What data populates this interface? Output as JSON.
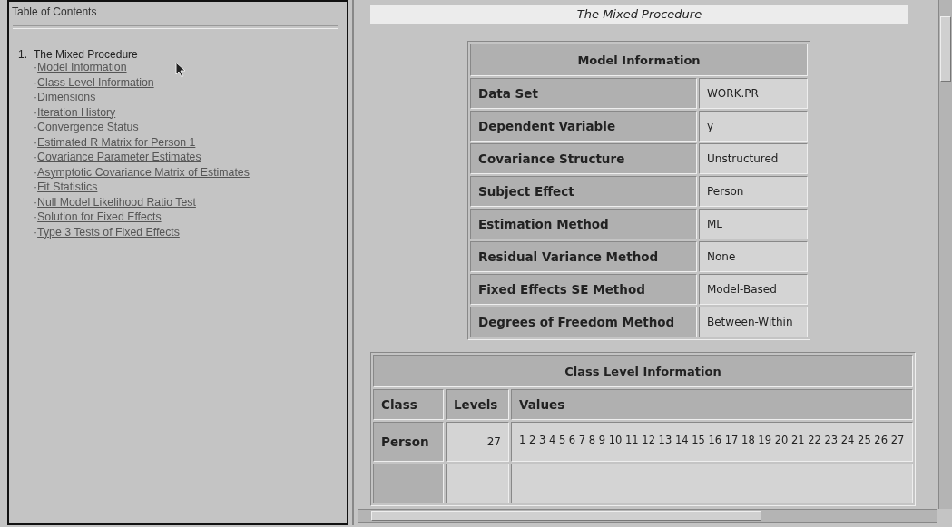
{
  "toc": {
    "title": "Table of Contents",
    "sections": [
      {
        "number": "1.",
        "title": "The Mixed Procedure",
        "links": [
          {
            "bullet": "·",
            "label": "Model Information"
          },
          {
            "bullet": "·",
            "label": "Class Level Information"
          },
          {
            "bullet": "·",
            "label": "Dimensions"
          },
          {
            "bullet": "·",
            "label": "Iteration History"
          },
          {
            "bullet": "·",
            "label": "Convergence Status"
          },
          {
            "bullet": "·",
            "label": "Estimated R Matrix for Person 1"
          },
          {
            "bullet": "·",
            "label": "Covariance Parameter Estimates"
          },
          {
            "bullet": "·",
            "label": "Asymptotic Covariance Matrix of Estimates"
          },
          {
            "bullet": "·",
            "label": "Fit Statistics"
          },
          {
            "bullet": "·",
            "label": "Null Model Likelihood Ratio Test"
          },
          {
            "bullet": "·",
            "label": "Solution for Fixed Effects"
          },
          {
            "bullet": "·",
            "label": "Type 3 Tests of Fixed Effects"
          }
        ]
      }
    ]
  },
  "output": {
    "procedure_title": "The Mixed Procedure",
    "model_information": {
      "title": "Model Information",
      "rows": [
        {
          "label": "Data Set",
          "value": "WORK.PR"
        },
        {
          "label": "Dependent Variable",
          "value": "y"
        },
        {
          "label": "Covariance Structure",
          "value": "Unstructured"
        },
        {
          "label": "Subject Effect",
          "value": "Person"
        },
        {
          "label": "Estimation Method",
          "value": "ML"
        },
        {
          "label": "Residual Variance Method",
          "value": "None"
        },
        {
          "label": "Fixed Effects SE Method",
          "value": "Model-Based"
        },
        {
          "label": "Degrees of Freedom Method",
          "value": "Between-Within"
        }
      ]
    },
    "class_level_information": {
      "title": "Class Level Information",
      "columns": [
        "Class",
        "Levels",
        "Values"
      ],
      "rows": [
        {
          "class": "Person",
          "levels": "27",
          "values": "1 2 3 4 5 6 7 8 9 10 11 12 13 14 15 16 17 18 19 20 21 22 23 24 25 26 27"
        }
      ]
    }
  }
}
